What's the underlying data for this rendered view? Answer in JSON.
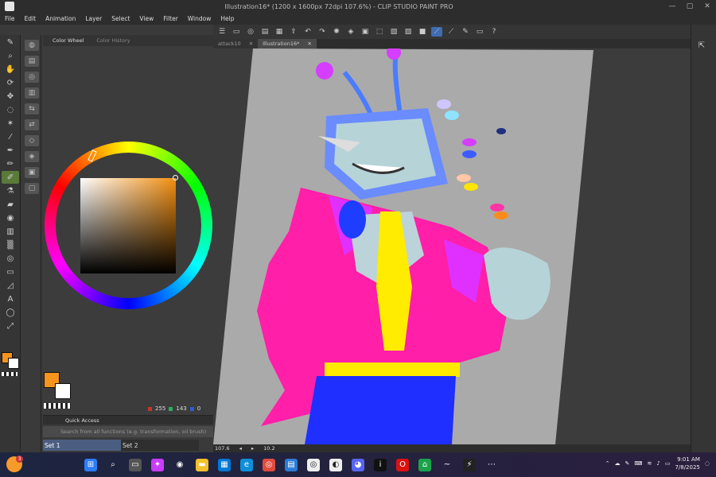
{
  "window": {
    "title": "Illustration16* (1200 x 1600px 72dpi 107.6%) - CLIP STUDIO PAINT PRO",
    "minimize": "—",
    "maximize": "▢",
    "close": "✕"
  },
  "menu": [
    "File",
    "Edit",
    "Animation",
    "Layer",
    "Select",
    "View",
    "Filter",
    "Window",
    "Help"
  ],
  "tools": [
    "pen-icon",
    "zoom-icon",
    "hand-icon",
    "rotate-icon",
    "move-icon",
    "lasso-icon",
    "auto-select-icon",
    "eyedropper-icon",
    "pen-tool-icon",
    "pencil-icon",
    "brush-icon",
    "airbrush-icon",
    "eraser-icon",
    "blend-icon",
    "fill-icon",
    "gradient-icon",
    "figure-icon",
    "frame-icon",
    "ruler-icon",
    "text-icon",
    "balloon-icon",
    "correct-line-icon"
  ],
  "color_panel": {
    "tabs": [
      "Color Wheel",
      "Color History"
    ],
    "main_color": "#f7941d",
    "sub_color": "#ffffff",
    "rgb": {
      "r": "255",
      "g": "143",
      "b": "0"
    }
  },
  "quick_access": {
    "title": "Quick Access",
    "search_placeholder": "Search from all functions (e.g. transformation, oil brush)",
    "sets": [
      "Set 1",
      "Set 2"
    ]
  },
  "documents": {
    "tabs": [
      "attack10",
      "Illustration16*"
    ],
    "active": 1
  },
  "status": {
    "zoom": "107.6",
    "rotation": "10.2"
  },
  "taskbar": {
    "time": "9:01 AM",
    "date": "7/8/2025",
    "notification_count": "3"
  }
}
